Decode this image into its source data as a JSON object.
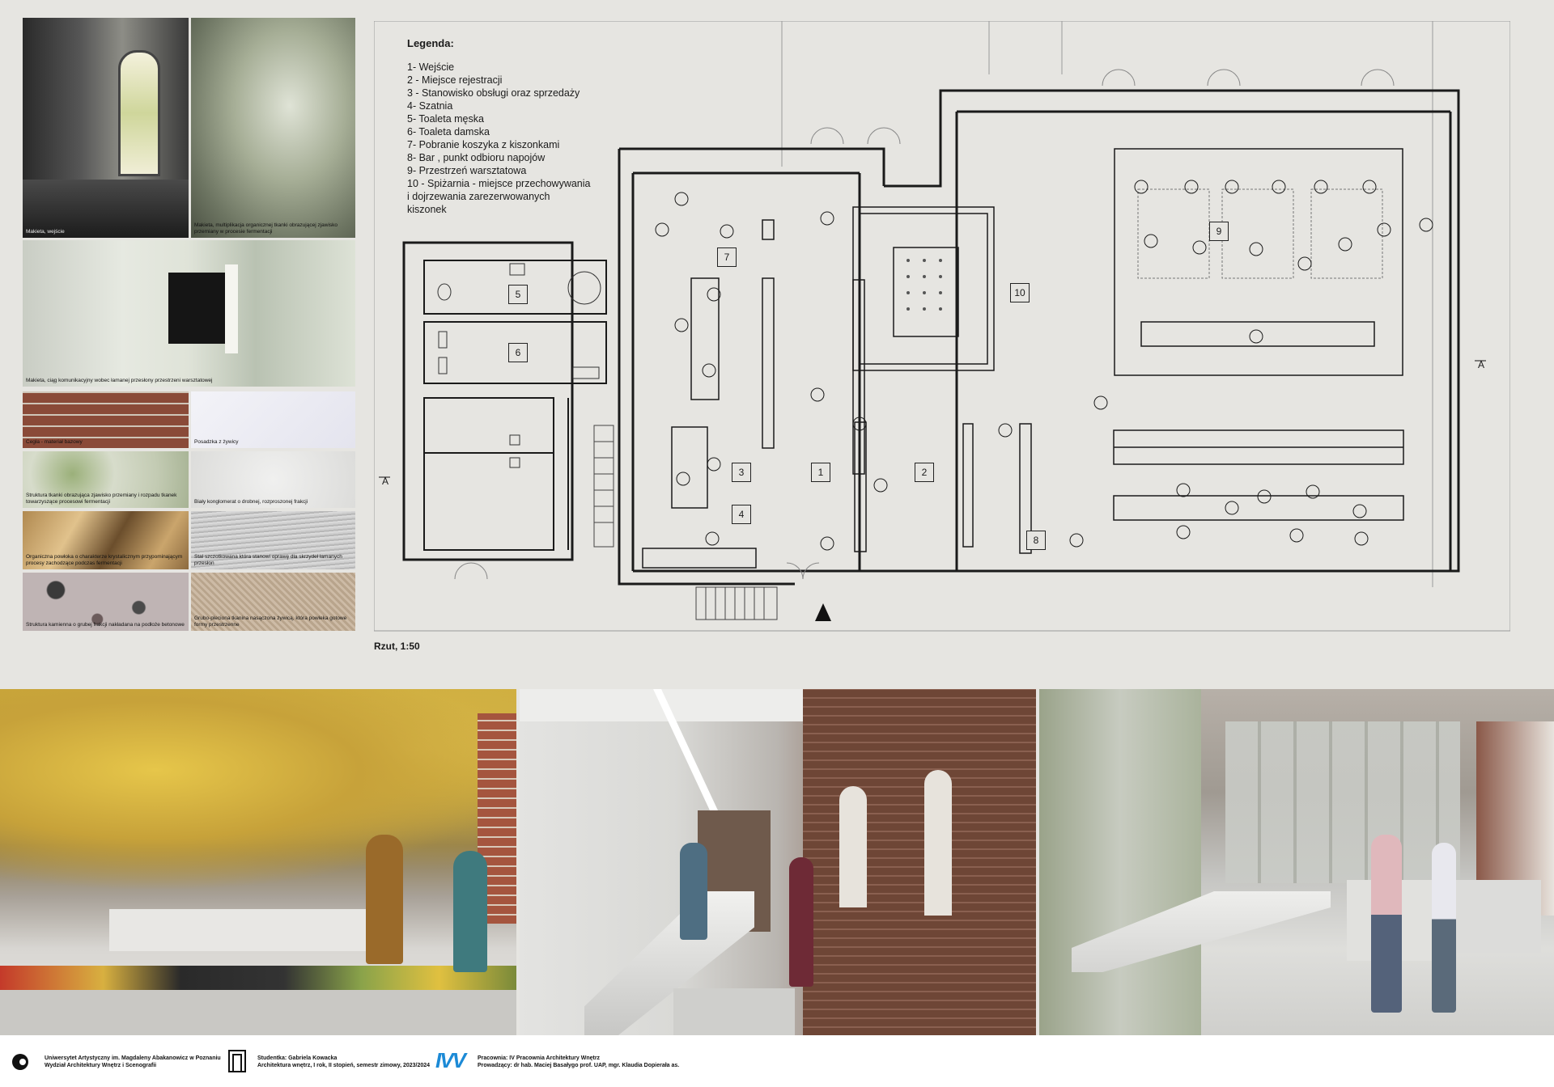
{
  "collage": {
    "captions": [
      "Makieta, wejście",
      "Makieta, multiplikacja organicznej tkanki obrazującej zjawisko przemiany w procesie fermentacji",
      "Makieta, ciąg  komunikacyjny wobec łamanej przesłony przestrzeni warsztatowej",
      "Cegła - materiał bazowy",
      "Posadzka z żywicy",
      "Struktura tkanki obrazująca zjawisko przemiany i rozpadu tkanek towarzyszące procesowi fermentacji",
      "Biały konglomerat o drobnej, rozproszonej frakcji",
      "Organiczna powłoka o charakterze krystalicznym przypominającym procesy zachodzące podczas fermentacji",
      "Stal szczotkowana która stanowi oprawę dla skrzydeł łamanych przesłon",
      "Struktura kamienna o grubej frakcji nakładana na podłoże betonowe",
      "Grubo-pleciona tkanina nasączona żywicą, która  powleka gotowe formy przestrzenne"
    ]
  },
  "legend": {
    "title": "Legenda:",
    "items": [
      "1- Wejście",
      "2 - Miejsce rejestracji",
      "3 - Stanowisko obsługi oraz sprzedaży",
      "4- Szatnia",
      "5- Toaleta męska",
      "6- Toaleta damska",
      "7- Pobranie koszyka z kiszonkami",
      "8- Bar , punkt odbioru napojów",
      "9- Przestrzeń warsztatowa",
      "10 - Spiżarnia - miejsce przechowywania",
      "i dojrzewania zarezerwowanych",
      "kiszonek"
    ]
  },
  "plan": {
    "scale_label": "Rzut, 1:50",
    "section_label": "A",
    "rooms": [
      "1",
      "2",
      "3",
      "4",
      "5",
      "6",
      "7",
      "8",
      "9",
      "10"
    ]
  },
  "footer": {
    "university_line1": "Uniwersytet Artystyczny im. Magdaleny Abakanowicz w Poznaniu",
    "university_line2": "Wydział Architektury Wnętrz i Scenografii",
    "student_line1": "Studentka: Gabriela Kowacka",
    "student_line2": "Architektura wnętrz, I rok, II stopień, semestr zimowy, 2023/2024",
    "studio_line1": "Pracownia: IV Pracownia Architektury Wnętrz",
    "studio_line2": "Prowadzący: dr hab. Maciej Basałygo prof. UAP,  mgr.  Klaudia Dopierała  as.",
    "studio_logo": "IVV"
  },
  "colors": {
    "background": "#e6e5e1",
    "line": "#1a1a1a",
    "accent_logo": "#1c8ad6"
  }
}
